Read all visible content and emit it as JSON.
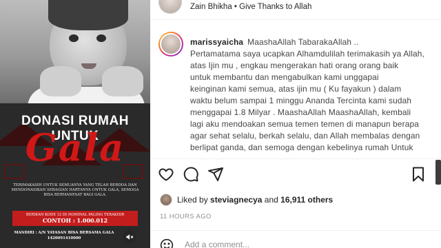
{
  "poster": {
    "title": "DONASI RUMAH UNTUK",
    "script_name": "Gala",
    "body_text": "TERIMAKASIH UNTUK SEMUANYA YANG TELAH BERDOA DAN MENDONASIKAN SEBAGIAN HARTANYA UNTUK GALA, SEMOGA BISA BERMANFAAT BAGI GALA.",
    "banner_line1": "BERIKAN KODE 12 DI NOMINAL PALING TERAKHIR",
    "banner_line2": "CONTOH : 1.000.012",
    "bank_line1": "MANDIRI : A/N YAYASAN BISA BERSAMA GALA",
    "bank_line2": "1420091410000",
    "icons": {
      "mute": "speaker-muted-icon"
    }
  },
  "post": {
    "header": "Zain Bhikha • Give Thanks to Allah",
    "caption": {
      "username": "marissyaicha",
      "lines": [
        "MaashaAllah TabarakaAllah ..",
        "Pertamatama saya ucapkan Alhamdulilah terimakasih ya Allah,",
        "atas Ijin mu , engkau mengerakan hati orang orang baik",
        "untuk membantu dan mengabulkan kami unggapai",
        "keinginan kami semua, atas ijin mu ( Ku fayakun ) dalam",
        "waktu belum sampai 1 minggu Ananda Tercinta kami sudah",
        "menggapai 1.8 Milyar . MaashaAllah MaashaAllah, kembali",
        "lagi aku mendoakan semua temen temen di manapun berapa",
        "agar sehat selalu, berkah selalu, dan Allah membalas dengan",
        "berlipat ganda, dan semoga dengan kebelinya rumah Untuk"
      ]
    },
    "actions": {
      "like": "heart-icon",
      "comment": "comment-icon",
      "share": "send-icon",
      "save": "bookmark-icon"
    },
    "likes": {
      "prefix": "Liked by",
      "user": "steviagnecya",
      "connector": "and",
      "count": "16,911 others"
    },
    "timestamp": "11 HOURS AGO",
    "comment_placeholder": "Add a comment..."
  },
  "colors": {
    "accent_red": "#c41d1d",
    "script_red": "#d01818",
    "text_main": "#262626",
    "text_muted": "#8e8e8e"
  }
}
